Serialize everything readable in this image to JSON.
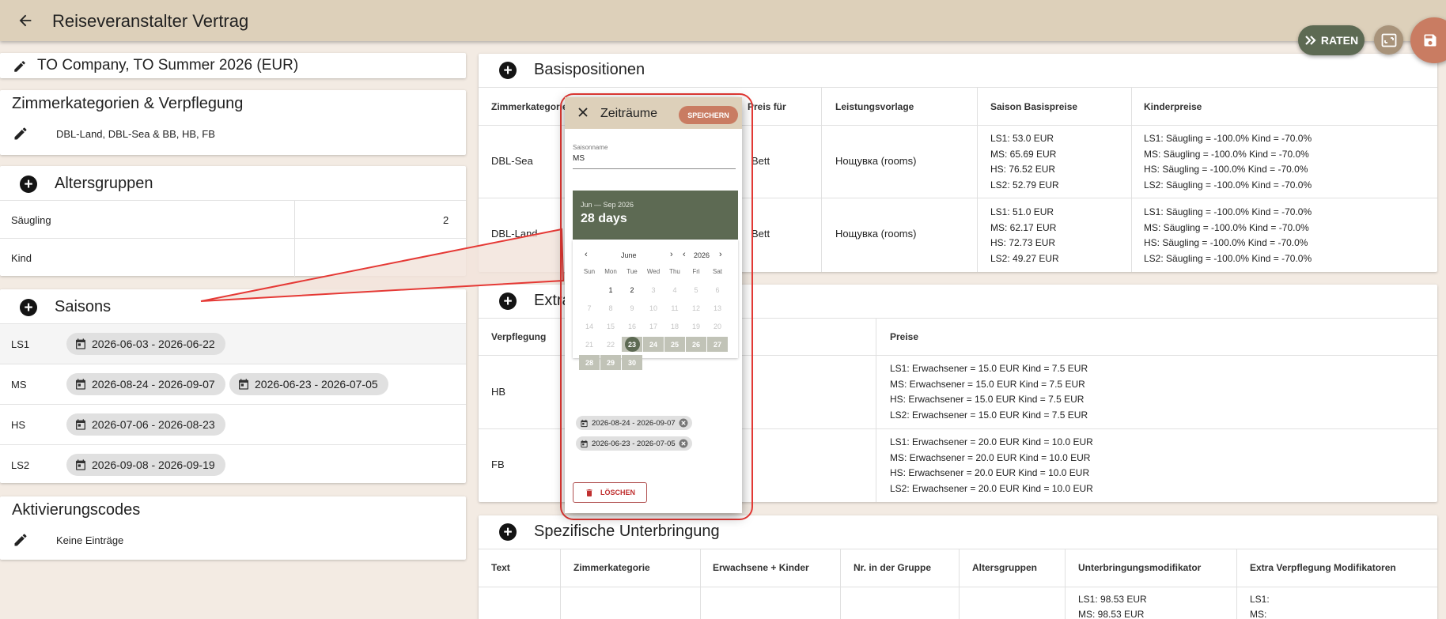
{
  "app": {
    "title": "Reiseveranstalter Vertrag"
  },
  "fab": {
    "raten_label": "RATEN"
  },
  "contract": {
    "title": "TO Company, TO Summer 2026 (EUR)"
  },
  "zimmer": {
    "title": "Zimmerkategorien & Verpflegung",
    "summary": "DBL-Land, DBL-Sea & BB, HB, FB"
  },
  "alter": {
    "title": "Altersgruppen",
    "rows": [
      {
        "label": "Säugling",
        "value": "2"
      },
      {
        "label": "Kind",
        "value": ""
      }
    ]
  },
  "saisons": {
    "title": "Saisons",
    "rows": [
      {
        "label": "LS1",
        "chips": [
          "2026-06-03 - 2026-06-22"
        ]
      },
      {
        "label": "MS",
        "chips": [
          "2026-08-24 - 2026-09-07",
          "2026-06-23 - 2026-07-05"
        ]
      },
      {
        "label": "HS",
        "chips": [
          "2026-07-06 - 2026-08-23"
        ]
      },
      {
        "label": "LS2",
        "chips": [
          "2026-09-08 - 2026-09-19"
        ]
      }
    ]
  },
  "aktiv": {
    "title": "Aktivierungscodes",
    "empty": "Keine Einträge"
  },
  "basis": {
    "title": "Basispositionen",
    "headers": [
      "Zimmerkategorie",
      "",
      "Preis für",
      "Leistungsvorlage",
      "Saison Basispreise",
      "Kinderpreise"
    ],
    "rows": [
      {
        "zimmer": "DBL-Sea",
        "preis_fuer": "Bett",
        "vorlage": "Нощувка (rooms)",
        "saison": [
          "LS1:    53.0 EUR",
          "MS:    65.69 EUR",
          "HS:    76.52 EUR",
          "LS2:    52.79 EUR"
        ],
        "kinder": [
          "LS1:    Säugling = -100.0%    Kind = -70.0%",
          "MS:    Säugling = -100.0%    Kind = -70.0%",
          "HS:    Säugling = -100.0%    Kind = -70.0%",
          "LS2:    Säugling = -100.0%    Kind = -70.0%"
        ]
      },
      {
        "zimmer": "DBL-Land",
        "preis_fuer": "Bett",
        "vorlage": "Нощувка (rooms)",
        "saison": [
          "LS1:    51.0 EUR",
          "MS:    62.17 EUR",
          "HS:    72.73 EUR",
          "LS2:    49.27 EUR"
        ],
        "kinder": [
          "LS1:    Säugling = -100.0%    Kind = -70.0%",
          "MS:    Säugling = -100.0%    Kind = -70.0%",
          "HS:    Säugling = -100.0%    Kind = -70.0%",
          "LS2:    Säugling = -100.0%    Kind = -70.0%"
        ]
      }
    ]
  },
  "extra": {
    "title": "Extra",
    "headers": [
      "Verpflegung",
      "Preise"
    ],
    "rows": [
      {
        "name": "HB",
        "preise": [
          "LS1:    Erwachsener = 15.0 EUR    Kind = 7.5 EUR",
          "MS:    Erwachsener = 15.0 EUR    Kind = 7.5 EUR",
          "HS:    Erwachsener = 15.0 EUR    Kind = 7.5 EUR",
          "LS2:    Erwachsener = 15.0 EUR    Kind = 7.5 EUR"
        ]
      },
      {
        "name": "FB",
        "preise": [
          "LS1:    Erwachsener = 20.0 EUR    Kind = 10.0 EUR",
          "MS:    Erwachsener = 20.0 EUR    Kind = 10.0 EUR",
          "HS:    Erwachsener = 20.0 EUR    Kind = 10.0 EUR",
          "LS2:    Erwachsener = 20.0 EUR    Kind = 10.0 EUR"
        ]
      }
    ]
  },
  "spez": {
    "title": "Spezifische Unterbringung",
    "headers": [
      "Text",
      "Zimmerkategorie",
      "Erwachsene + Kinder",
      "Nr. in der Gruppe",
      "Altersgruppen",
      "Unterbringungsmodifikator",
      "Extra Verpflegung Modifikatoren"
    ],
    "mod_lines": [
      "LS1:    98.53 EUR",
      "MS:    98.53 EUR"
    ],
    "extra_lines": [
      "LS1:",
      "MS:"
    ]
  },
  "dialog": {
    "title": "Zeiträume",
    "save_label": "SPEICHERN",
    "field_label": "Saisonname",
    "field_value": "MS",
    "cal_range": "Jun — Sep 2026",
    "cal_days": "28 days",
    "month": "June",
    "year": "2026",
    "weekdays": [
      "Sun",
      "Mon",
      "Tue",
      "Wed",
      "Thu",
      "Fri",
      "Sat"
    ],
    "chips": [
      "2026-08-24 - 2026-09-07",
      "2026-06-23 - 2026-07-05"
    ],
    "delete_label": "LÖSCHEN"
  },
  "calendar": {
    "days": [
      [
        null,
        1,
        2,
        3,
        4,
        5,
        6
      ],
      [
        7,
        8,
        9,
        10,
        11,
        12,
        13
      ],
      [
        14,
        15,
        16,
        17,
        18,
        19,
        20
      ],
      [
        21,
        22,
        23,
        24,
        25,
        26,
        27
      ],
      [
        28,
        29,
        30,
        null,
        null,
        null,
        null
      ]
    ],
    "enabled": [
      1,
      2
    ],
    "selected": 23,
    "range_end": 30
  },
  "colors": {
    "header": "#ddd0ba",
    "accent_green": "#5d6a53",
    "accent_red": "#c97c62",
    "background": "#f3ebe3",
    "callout": "#e53935"
  }
}
